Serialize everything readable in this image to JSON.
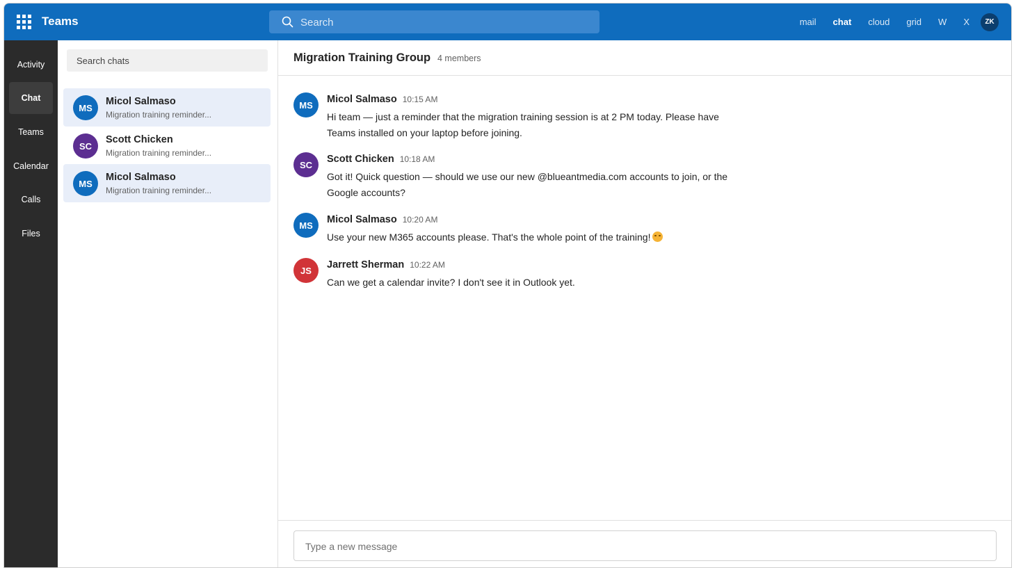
{
  "topbar": {
    "app_name": "Teams",
    "search_placeholder": "Search",
    "nav": [
      "mail",
      "chat",
      "cloud",
      "grid",
      "W",
      "X"
    ],
    "active_nav": "chat",
    "user_initials": "ZK"
  },
  "rail": {
    "items": [
      "Activity",
      "Chat",
      "Teams",
      "Calendar",
      "Calls",
      "Files"
    ],
    "active": "Chat"
  },
  "chat_list": {
    "search_placeholder": "Search chats",
    "items": [
      {
        "initials": "MS",
        "name": "Micol Salmaso",
        "preview": "Migration training reminder...",
        "avatar_color": "#0f6cbd",
        "selected": true
      },
      {
        "initials": "SC",
        "name": "Scott Chicken",
        "preview": "Migration training reminder...",
        "avatar_color": "#5c2e91",
        "selected": false
      },
      {
        "initials": "MS",
        "name": "Micol Salmaso",
        "preview": "Migration training reminder...",
        "avatar_color": "#0f6cbd",
        "selected": true
      }
    ]
  },
  "conversation": {
    "title": "Migration Training Group",
    "members": "4 members",
    "messages": [
      {
        "initials": "MS",
        "sender": "Micol Salmaso",
        "time": "10:15 AM",
        "text": "Hi team — just a reminder that the migration training session is at 2 PM today. Please have Teams installed on your laptop before joining.",
        "avatar_color": "#0f6cbd"
      },
      {
        "initials": "SC",
        "sender": "Scott Chicken",
        "time": "10:18 AM",
        "text": "Got it! Quick question — should we use our new @blueantmedia.com accounts to join, or the Google accounts?",
        "avatar_color": "#5c2e91"
      },
      {
        "initials": "MS",
        "sender": "Micol Salmaso",
        "time": "10:20 AM",
        "text": "Use your new M365 accounts please. That's the whole point of the training!",
        "avatar_color": "#0f6cbd",
        "emoji": "smiling-face-icon"
      },
      {
        "initials": "JS",
        "sender": "Jarrett Sherman",
        "time": "10:22 AM",
        "text": "Can we get a calendar invite? I don't see it in Outlook yet.",
        "avatar_color": "#d13438"
      }
    ],
    "composer_placeholder": "Type a new message"
  }
}
